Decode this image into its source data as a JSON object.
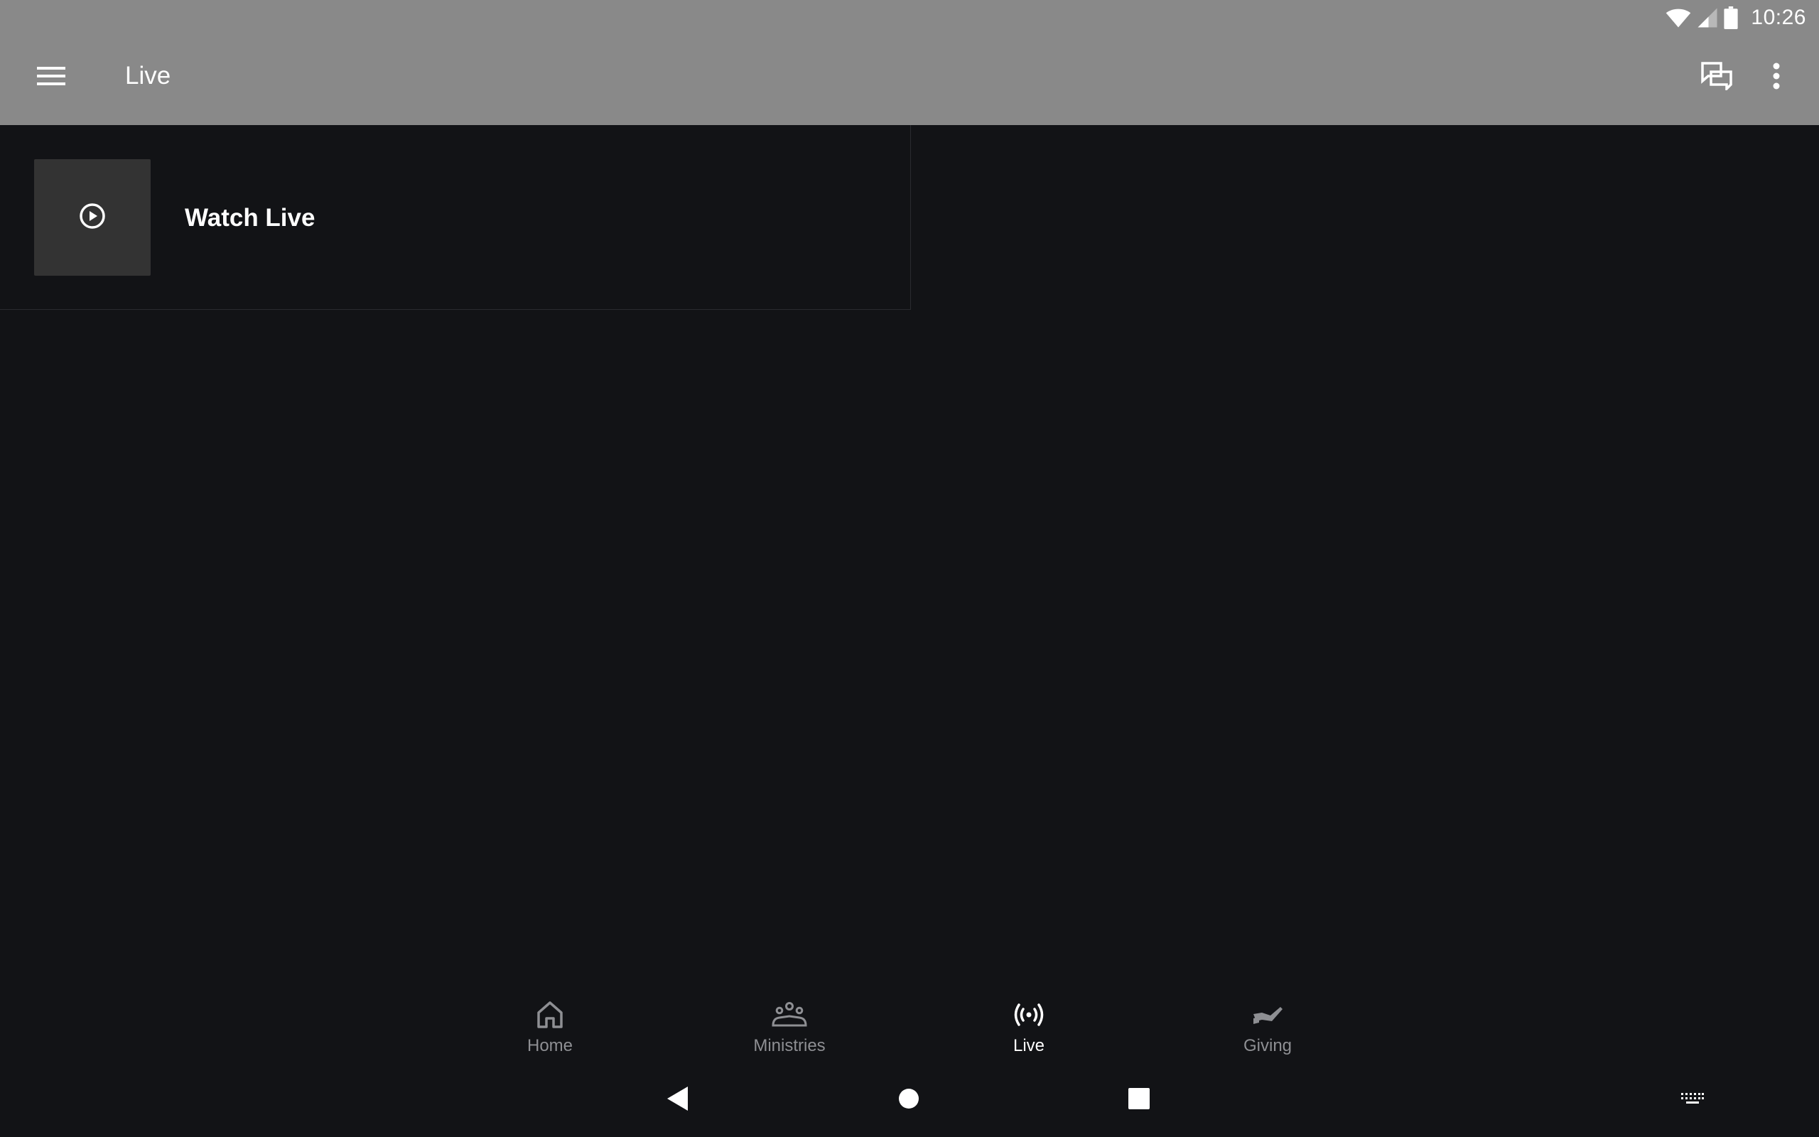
{
  "status_bar": {
    "time": "10:26",
    "icons": [
      "wifi-icon",
      "cell-signal-icon",
      "battery-icon"
    ]
  },
  "app_bar": {
    "title": "Live",
    "menu_icon": "hamburger-menu-icon",
    "chat_icon": "chat-icon",
    "more_icon": "more-vert-icon"
  },
  "list": {
    "items": [
      {
        "title": "Watch Live",
        "icon": "play-circle-icon"
      }
    ]
  },
  "bottom_nav": {
    "items": [
      {
        "label": "Home",
        "icon": "home-icon",
        "active": false
      },
      {
        "label": "Ministries",
        "icon": "groups-icon",
        "active": false
      },
      {
        "label": "Live",
        "icon": "live-broadcast-icon",
        "active": true
      },
      {
        "label": "Giving",
        "icon": "giving-hand-icon",
        "active": false
      }
    ]
  },
  "colors": {
    "app_bar": "#898989",
    "background": "#121316",
    "thumb": "#333333",
    "nav_inactive": "#8e8f93",
    "nav_active": "#ffffff"
  }
}
